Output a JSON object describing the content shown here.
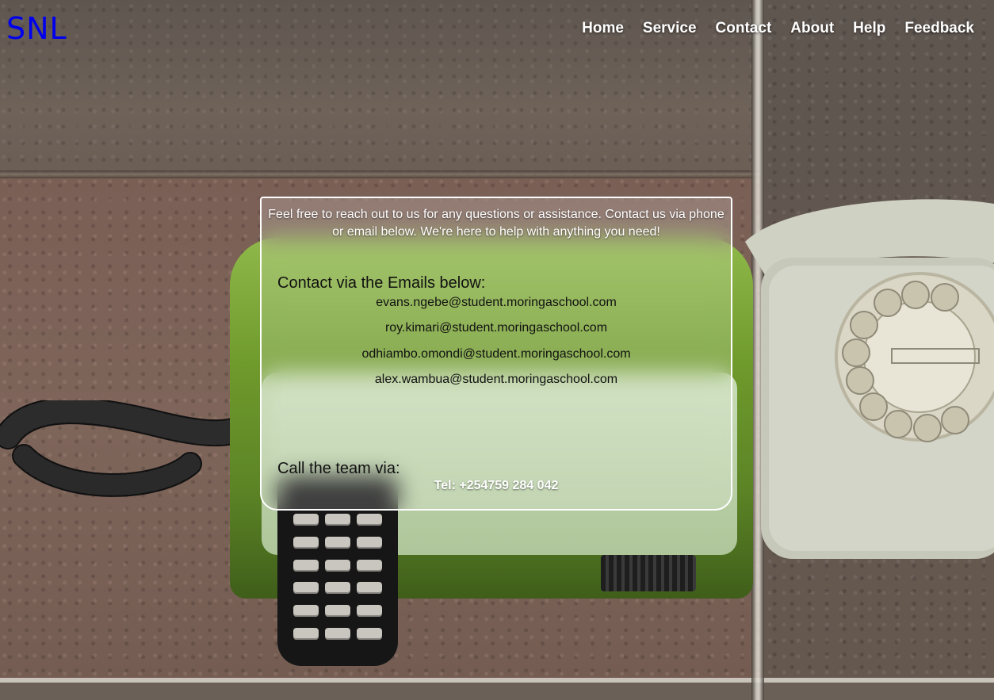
{
  "brand": {
    "logo_text": "SNL"
  },
  "nav": {
    "items": [
      {
        "label": "Home"
      },
      {
        "label": "Service"
      },
      {
        "label": "Contact"
      },
      {
        "label": "About"
      },
      {
        "label": "Help"
      },
      {
        "label": "Feedback"
      }
    ]
  },
  "contact": {
    "intro": "Feel free to reach out to us for any questions or assistance. Contact us via phone or email below. We're here to help with anything you need!",
    "email_heading": "Contact via the Emails below:",
    "emails": [
      "evans.ngebe@student.moringaschool.com",
      "roy.kimari@student.moringaschool.com",
      "odhiambo.omondi@student.moringaschool.com",
      "alex.wambua@student.moringaschool.com"
    ],
    "call_heading": "Call the team via:",
    "tel": "Tel: +254759 284 042"
  },
  "colors": {
    "logo": "#0000ee",
    "nav_text": "#ffffff",
    "card_border": "#ffffff"
  }
}
